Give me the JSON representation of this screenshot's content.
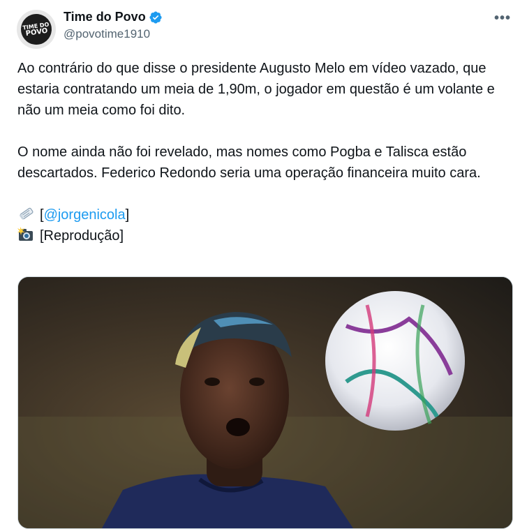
{
  "author": {
    "display_name": "Time do Povo",
    "handle": "@povotime1910",
    "avatar_text_line1": "TIME DO",
    "avatar_text_line2": "POVO"
  },
  "menu": {
    "more_label": "•••"
  },
  "tweet": {
    "paragraph1": "Ao contrário do que disse o presidente Augusto Melo em vídeo vazado, que estaria contratando um meia de 1,90m, o jogador em questão é um volante e não um meia como foi dito.",
    "paragraph2": "O nome ainda não foi revelado, mas nomes como Pogba e Talisca estão descartados. Federico Redondo seria uma operação financeira muito cara.",
    "source_prefix": "[",
    "source_mention": "@jorgenicola",
    "source_suffix": "]",
    "photo_credit": "[Reprodução]"
  },
  "icons": {
    "verified": "verified-badge-icon",
    "newspaper": "newspaper-icon",
    "camera": "camera-flash-icon",
    "more": "more-icon"
  },
  "colors": {
    "accent": "#1d9bf0",
    "text": "#0f1419",
    "secondary": "#536471"
  }
}
